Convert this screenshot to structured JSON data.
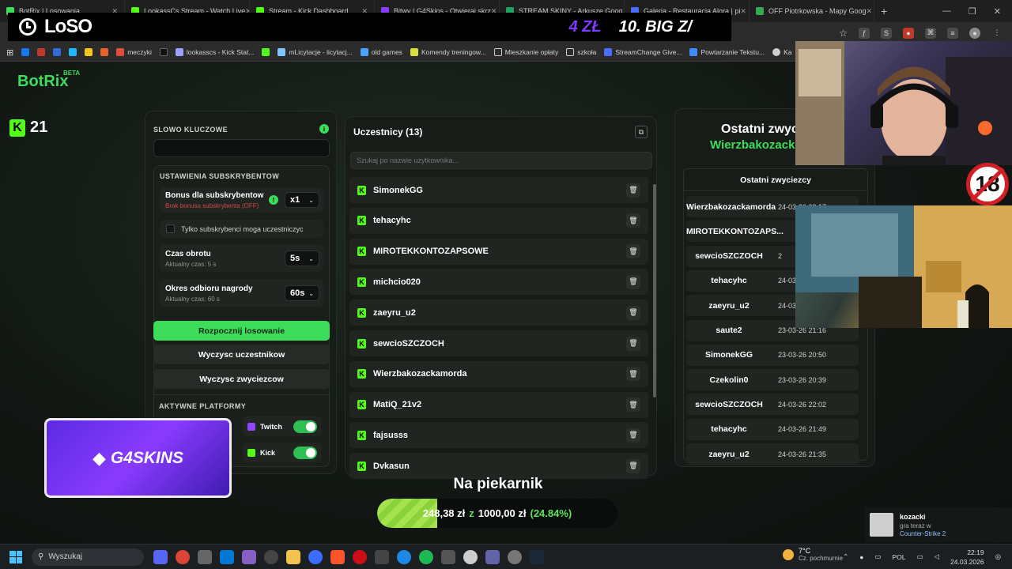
{
  "browser": {
    "tabs": [
      {
        "label": "BotRix | Losowania",
        "color": "#3ddc5a"
      },
      {
        "label": "LookassCs Stream - Watch Live",
        "color": "#53fc18"
      },
      {
        "label": "Stream - Kick Dashboard",
        "color": "#53fc18"
      },
      {
        "label": "Bitwy | G4Skins - Otwieraj skrz",
        "color": "#8a3bff"
      },
      {
        "label": "STREAM SKINY - Arkusze Goog",
        "color": "#1ea362"
      },
      {
        "label": "Galeria - Restauracja Alora | pi",
        "color": "#4a6cff"
      },
      {
        "label": "OFF Piotrkowska - Mapy Goog",
        "color": "#34a853"
      }
    ],
    "new_tab": "+",
    "bookmarks": [
      {
        "label": "meczyki",
        "color": "#e14b3b"
      },
      {
        "label": "lookasscs - Kick Stat...",
        "color": "#9aa0ff"
      },
      {
        "label": "mLicytacje - licytacj...",
        "color": "#7fc8ff"
      },
      {
        "label": "old games",
        "color": "#4aa3ff"
      },
      {
        "label": "Komendy treningow...",
        "color": "#dcdc3c"
      },
      {
        "label": "Mieszkanie opłaty",
        "color": "#cfcfcf"
      },
      {
        "label": "szkoła",
        "color": "#cfcfcf"
      },
      {
        "label": "StreamChange Give...",
        "color": "#4a6cff"
      },
      {
        "label": "Powtarzanie Tekstu...",
        "color": "#3d8bff"
      },
      {
        "label": "Ka",
        "color": "#cfcfcf"
      }
    ]
  },
  "overlay": {
    "brand": "LoSO",
    "top_right_1": "4 ZŁ",
    "top_right_2": "10. BIG Z/",
    "g4skins": "G4SKINS",
    "badge": "18"
  },
  "app": {
    "logo": "BotRix",
    "beta": "BETA",
    "kick_count": "21"
  },
  "settings": {
    "keyword_label": "SLOWO KLUCZOWE",
    "keyword_value": "",
    "sub_section": "USTAWIENIA SUBSKRYBENTOW",
    "bonus_title": "Bonus dla subskrybentow",
    "bonus_sub": "Brak bonusu subskrybenta (OFF)",
    "bonus_value": "x1",
    "subs_only": "Tylko subskrybenci moga uczestniczyc",
    "spin_title": "Czas obrotu",
    "spin_sub": "Aktualny czas: 5 s",
    "spin_value": "5s",
    "claim_title": "Okres odbioru nagrody",
    "claim_sub": "Aktualny czas: 60 s",
    "claim_value": "60s",
    "start_button": "Rozpocznij losowanie",
    "clear_participants": "Wyczysc uczestnikow",
    "clear_winners": "Wyczysc zwyciezcow",
    "platforms_label": "AKTYWNE PLATFORMY",
    "platform_twitch": "Twitch",
    "platform_kick": "Kick"
  },
  "participants": {
    "title": "Uczestnicy (13)",
    "search_placeholder": "Szukaj po nazwie uzytkownika...",
    "items": [
      "SimonekGG",
      "tehacyhc",
      "MIROTEKKONTOZAPSOWE",
      "michcio020",
      "zaeyru_u2",
      "sewcioSZCZOCH",
      "Wierzbakozackamorda",
      "MatiQ_21v2",
      "fajsusss",
      "Dvkasun"
    ]
  },
  "winners": {
    "header": "Ostatni zwyci",
    "highlight": "Wierzbakozack",
    "list_title": "Ostatni zwyciezcy",
    "rows": [
      {
        "name": "Wierzbakozackamorda",
        "date": "24-03-26 22:17"
      },
      {
        "name": "MIROTEKKONTOZAPS...",
        "date": ""
      },
      {
        "name": "sewcioSZCZOCH",
        "date": "2"
      },
      {
        "name": "tehacyhc",
        "date": "24-03"
      },
      {
        "name": "zaeyru_u2",
        "date": "24-03"
      },
      {
        "name": "saute2",
        "date": "23-03-26 21:16"
      },
      {
        "name": "SimonekGG",
        "date": "23-03-26 20:50"
      },
      {
        "name": "Czekolin0",
        "date": "23-03-26 20:39"
      },
      {
        "name": "sewcioSZCZOCH",
        "date": "24-03-26 22:02"
      },
      {
        "name": "tehacyhc",
        "date": "24-03-26 21:49"
      },
      {
        "name": "zaeyru_u2",
        "date": "24-03-26 21:35"
      }
    ]
  },
  "goal": {
    "title": "Na piekarnik",
    "current": "248,38 zł",
    "sep": "z",
    "target": "1000,00 zł",
    "percent": "(24.84%)",
    "fraction": 0.2484
  },
  "now_playing": {
    "user": "kozacki",
    "status": "gra teraz w",
    "game": "Counter-Strike 2"
  },
  "taskbar": {
    "search": "Wyszukaj",
    "temp": "7°C",
    "weather": "Cz. pochmurnie",
    "lang": "POL",
    "time": "22:19",
    "date": "24.03.2026"
  }
}
